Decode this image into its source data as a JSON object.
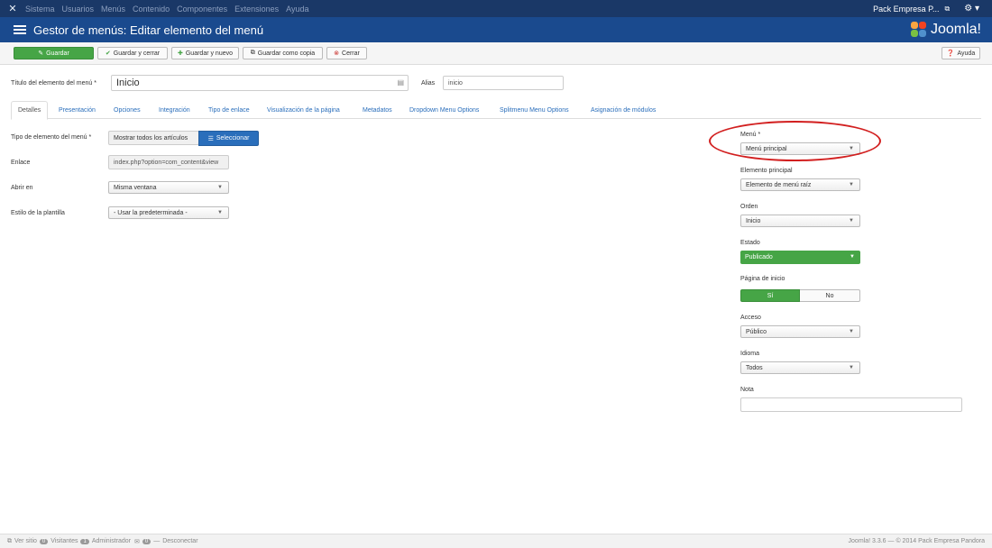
{
  "topnav": {
    "menu": [
      "Sistema",
      "Usuarios",
      "Menús",
      "Contenido",
      "Componentes",
      "Extensiones",
      "Ayuda"
    ],
    "user": "Pack Empresa P...",
    "external_icon": "external-link-icon",
    "gear_icon": "gear-icon"
  },
  "header": {
    "title": "Gestor de menús: Editar elemento del menú",
    "brand": "Joomla!"
  },
  "toolbar": {
    "save": "Guardar",
    "save_close": "Guardar y cerrar",
    "save_new": "Guardar y nuevo",
    "save_copy": "Guardar como copia",
    "close": "Cerrar",
    "help": "Ayuda"
  },
  "form": {
    "title_label": "Título del elemento del menú *",
    "title_value": "Inicio",
    "alias_label": "Alias",
    "alias_value": "inicio"
  },
  "tabs": [
    "Detalles",
    "Presentación",
    "Opciones",
    "Integración",
    "Tipo de enlace",
    "Visualización de la página",
    "Metadatos",
    "Dropdown Menu Options",
    "Splitmenu Menu Options",
    "Asignación de módulos"
  ],
  "details": {
    "type_label": "Tipo de elemento del menú *",
    "type_value": "Mostrar todos los artículos",
    "select_button": "Seleccionar",
    "link_label": "Enlace",
    "link_value": "index.php?option=com_content&view",
    "open_label": "Abrir en",
    "open_value": "Misma ventana",
    "template_label": "Estilo de la plantilla",
    "template_value": "- Usar la predeterminada -"
  },
  "sidebar": {
    "menu_label": "Menú *",
    "menu_value": "Menú principal",
    "parent_label": "Elemento principal",
    "parent_value": "Elemento de menú raíz",
    "order_label": "Orden",
    "order_value": "Inicio",
    "status_label": "Estado",
    "status_value": "Publicado",
    "home_label": "Página de inicio",
    "home_yes": "Sí",
    "home_no": "No",
    "access_label": "Acceso",
    "access_value": "Público",
    "language_label": "Idioma",
    "language_value": "Todos",
    "note_label": "Nota",
    "note_value": ""
  },
  "footer": {
    "view_site": "Ver sitio",
    "visitors_count": "0",
    "visitors": "Visitantes",
    "admin_count": "1",
    "admin": "Administrador",
    "messages_count": "0",
    "logout": "Desconectar",
    "copyright": "Joomla! 3.3.6 — © 2014 Pack Empresa Pandora"
  },
  "colors": {
    "topnav": "#1a3867",
    "header": "#1a4a8e",
    "success": "#46a546",
    "primary": "#2a6ebb",
    "highlight": "#d21f1f"
  }
}
